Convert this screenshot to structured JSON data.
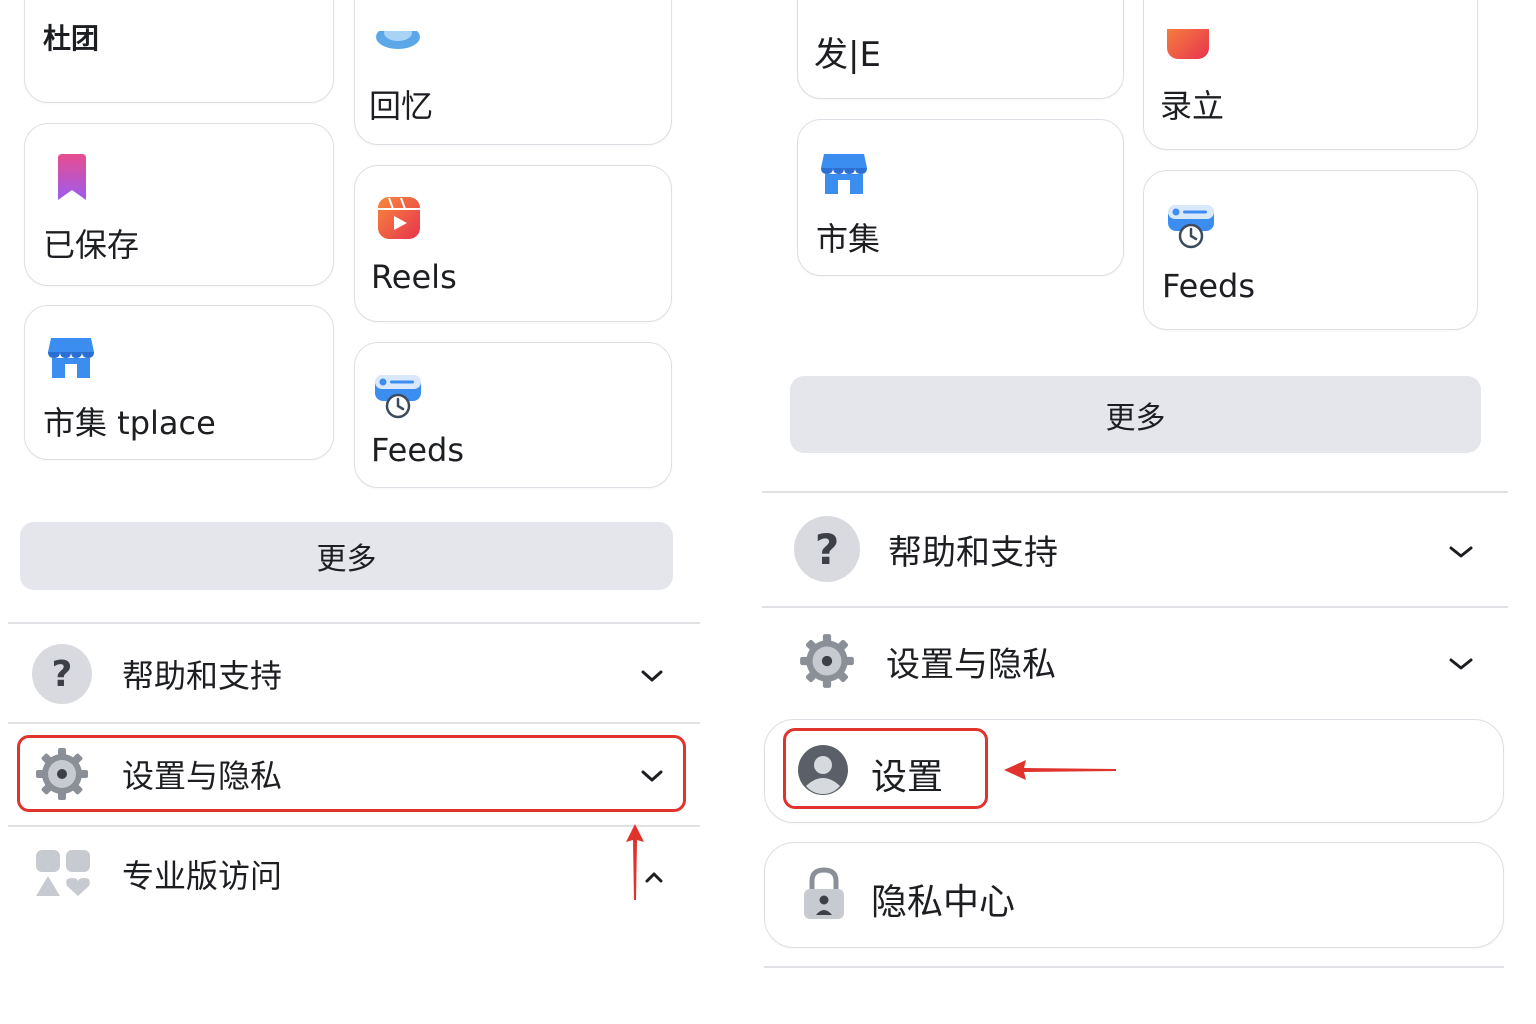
{
  "left": {
    "cards": {
      "groups": "杜团",
      "memories": "回忆",
      "saved": "已保存",
      "reels": "Reels",
      "marketplace": "市集 tplace",
      "feeds": "Feeds"
    },
    "more_label": "更多",
    "menu": {
      "help": "帮助和支持",
      "settings_privacy": "设置与隐私",
      "pro": "专业版访问"
    }
  },
  "right": {
    "cards": {
      "top_left": "发|E",
      "top_right": "录立",
      "marketplace": "市集",
      "feeds": "Feeds"
    },
    "more_label": "更多",
    "menu": {
      "help": "帮助和支持",
      "settings_privacy": "设置与隐私",
      "settings": "设置",
      "privacy_center": "隐私中心"
    }
  },
  "colors": {
    "highlight": "#e0332b",
    "button_bg": "#e4e6eb",
    "divider": "#dfe1e5",
    "text": "#1c1e21"
  },
  "icons": [
    "saved-icon",
    "reels-icon",
    "marketplace-icon",
    "feeds-icon",
    "memories-icon",
    "help-icon",
    "gear-icon",
    "pro-access-icon",
    "chevron-down-icon",
    "chevron-up-icon",
    "user-circle-icon",
    "lock-icon",
    "arrow-icon"
  ]
}
